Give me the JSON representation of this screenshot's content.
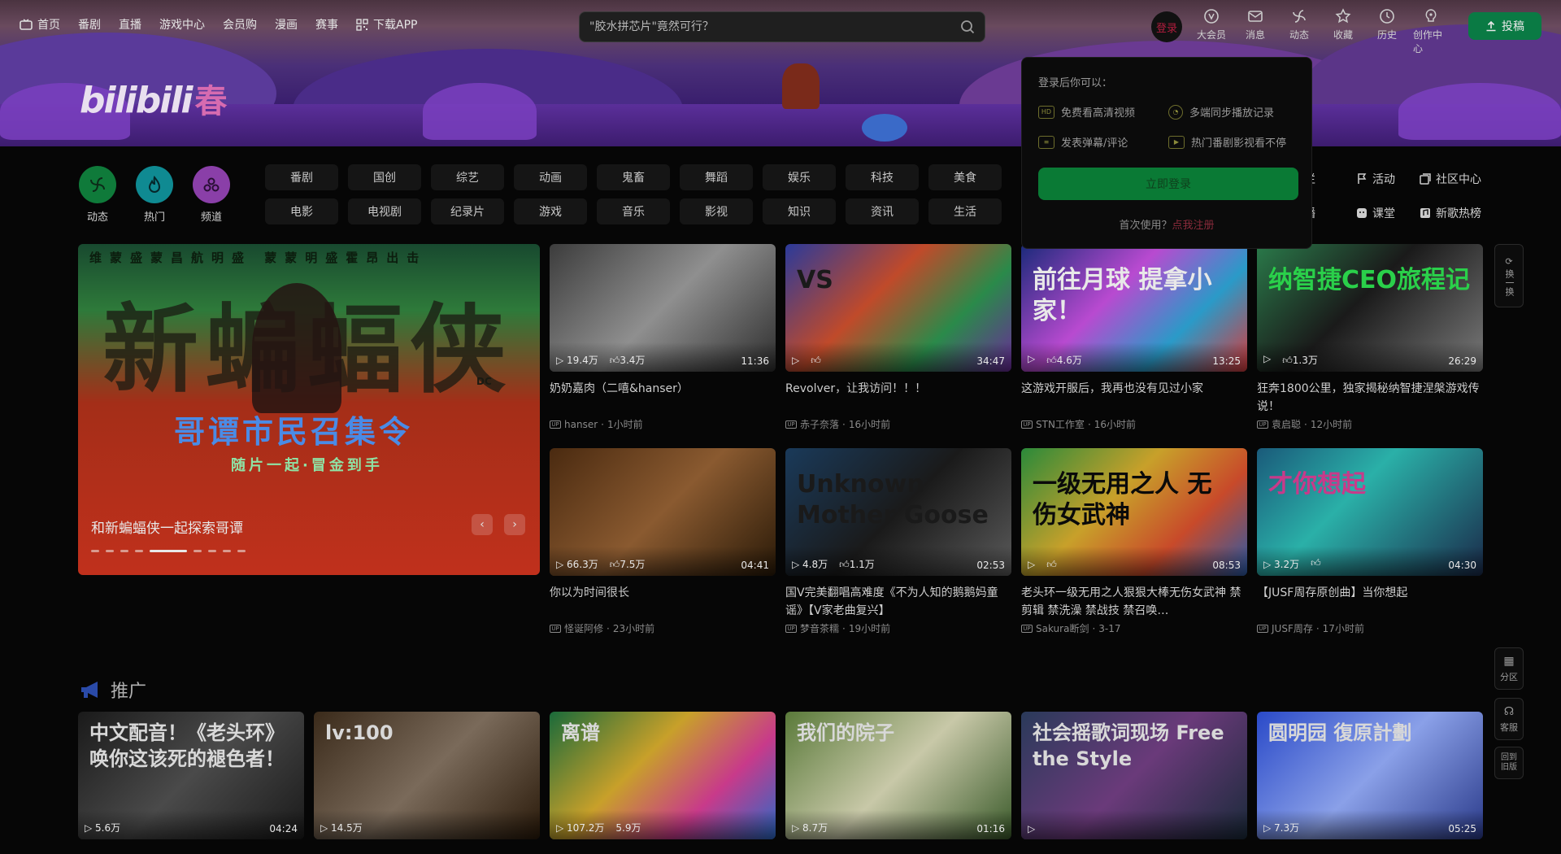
{
  "top_nav": {
    "items": [
      {
        "label": "首页",
        "icon": "tv-icon"
      },
      {
        "label": "番剧"
      },
      {
        "label": "直播"
      },
      {
        "label": "游戏中心"
      },
      {
        "label": "会员购"
      },
      {
        "label": "漫画"
      },
      {
        "label": "赛事"
      },
      {
        "label": "下载APP",
        "icon": "download-icon"
      }
    ]
  },
  "search": {
    "placeholder": "\"胶水拼芯片\"竟然可行？"
  },
  "user": {
    "login_avatar": "登录",
    "buttons": [
      "大会员",
      "消息",
      "动态",
      "收藏",
      "历史",
      "创作中心"
    ],
    "upload": "投稿"
  },
  "logo": {
    "text": "bilibili",
    "suffix": "春"
  },
  "channels": {
    "circles": [
      {
        "label": "动态",
        "color": "#0f7a3a"
      },
      {
        "label": "热门",
        "color": "#0f8a92"
      },
      {
        "label": "频道",
        "color": "#8a3fa8"
      }
    ],
    "row1": [
      "番剧",
      "国创",
      "综艺",
      "动画",
      "鬼畜",
      "舞蹈",
      "娱乐",
      "科技",
      "美食"
    ],
    "row2": [
      "电影",
      "电视剧",
      "纪录片",
      "游戏",
      "音乐",
      "影视",
      "知识",
      "资讯",
      "生活"
    ],
    "right_row1": [
      "专栏",
      "活动",
      "社区中心"
    ],
    "right_row2": [
      "直播",
      "课堂",
      "新歌热榜"
    ]
  },
  "hero": {
    "top_text": "维蒙盛蒙昌航明盛 蒙蒙明盛霍昂出击",
    "big_text": "新蝙蝠侠",
    "subtitle": "哥谭市民召集令",
    "subtitle2": "随片一起·冒金到手",
    "badge": "DC",
    "caption": "和新蝙蝠侠一起探索哥谭",
    "prev": "‹",
    "next": "›",
    "dot_count": 9,
    "active_dot": 4
  },
  "videos": [
    {
      "views": "19.4万",
      "likes": "3.4万",
      "duration": "11:36",
      "title": "奶奶嘉肉（二嘻&hanser）",
      "uploader": "hanser",
      "time": "1小时前"
    },
    {
      "views": "",
      "likes": "",
      "duration": "34:47",
      "title": "Revolver，让我访问！！！",
      "uploader": "赤子奈落",
      "time": "16小时前"
    },
    {
      "views": "",
      "likes": "4.6万",
      "duration": "13:25",
      "title": "这游戏开服后，我再也没有见过小家",
      "uploader": "STN工作室",
      "time": "16小时前"
    },
    {
      "views": "",
      "likes": "1.3万",
      "duration": "26:29",
      "title": "狂奔1800公里，独家揭秘纳智捷涅槃游戏传说！",
      "uploader": "袁启聪",
      "time": "12小时前"
    },
    {
      "views": "66.3万",
      "likes": "7.5万",
      "duration": "04:41",
      "title": "你以为时间很长",
      "uploader": "怪诞阿修",
      "time": "23小时前"
    },
    {
      "views": "4.8万",
      "likes": "1.1万",
      "duration": "02:53",
      "title": "国V完美翻唱高难度《不为人知的鹅鹅妈童谣》【V家老曲复兴】",
      "uploader": "梦音茶糯",
      "time": "19小时前"
    },
    {
      "views": "",
      "likes": "",
      "duration": "08:53",
      "title": "老头环一级无用之人狠狠大棒无伤女武神 禁剪辑 禁洗澡 禁战技 禁召唤…",
      "uploader": "Sakura断剑",
      "time": "3-17"
    },
    {
      "views": "3.2万",
      "likes": "",
      "duration": "04:30",
      "title": "【JUSF周存原创曲】当你想起",
      "uploader": "JUSF周存",
      "time": "17小时前"
    }
  ],
  "thumb_texts": [
    "",
    "VS",
    "前往月球 提拿小家！",
    "纳智捷CEO旅程记",
    "",
    "Unknown Mother Goose",
    "一级无用之人 无伤女武神",
    "才你想起"
  ],
  "login_popup": {
    "heading": "登录后你可以：",
    "features": [
      {
        "icon": "hd-icon",
        "text": "免费看高清视频"
      },
      {
        "icon": "clock-icon",
        "text": "多端同步播放记录"
      },
      {
        "icon": "danmaku-icon",
        "text": "发表弹幕/评论"
      },
      {
        "icon": "play-icon",
        "text": "热门番剧影视看不停"
      }
    ],
    "login_button": "立即登录",
    "register_prompt": "首次使用？",
    "register_link": "点我注册"
  },
  "side_tools": {
    "refresh": "换一换",
    "zone": "分区",
    "service": "客服",
    "back": "回到旧版"
  },
  "promo": {
    "title": "推广"
  },
  "promo_videos": [
    {
      "views": "5.6万",
      "likes": "",
      "duration": "04:24",
      "overlay": "中文配音！《老头环》 唤你这该死的褪色者！"
    },
    {
      "views": "14.5万",
      "likes": "",
      "duration": "",
      "overlay": "lv:100"
    },
    {
      "views": "107.2万",
      "likes": "5.9万",
      "duration": "",
      "overlay": "离谱"
    },
    {
      "views": "8.7万",
      "likes": "",
      "duration": "01:16",
      "overlay": "我们的院子"
    },
    {
      "views": "",
      "likes": "",
      "duration": "",
      "overlay": "社会摇歌词现场 Free the Style"
    },
    {
      "views": "7.3万",
      "likes": "",
      "duration": "05:25",
      "overlay": "圆明园 復原計劃"
    }
  ],
  "colors": {
    "accent_green": "#0a7a44",
    "page_bg": "#060606",
    "pill_bg": "#151515"
  }
}
